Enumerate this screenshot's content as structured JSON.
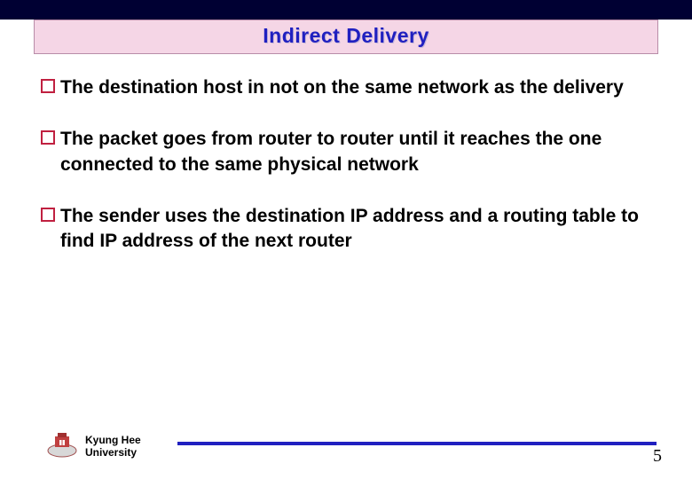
{
  "title": "Indirect Delivery",
  "bullets": [
    "The destination host in not on the same network as the delivery",
    "The packet goes from router to router until it reaches the one connected to the same physical network",
    "The sender uses the destination IP address and a routing table to find IP address of the next router"
  ],
  "footer": {
    "university_line1": "Kyung Hee",
    "university_line2": "University",
    "page_number": "5"
  },
  "colors": {
    "accent": "#2020c0",
    "title_bg": "#f5d6e6",
    "top_band": "#000033",
    "bullet": "#c02040"
  }
}
